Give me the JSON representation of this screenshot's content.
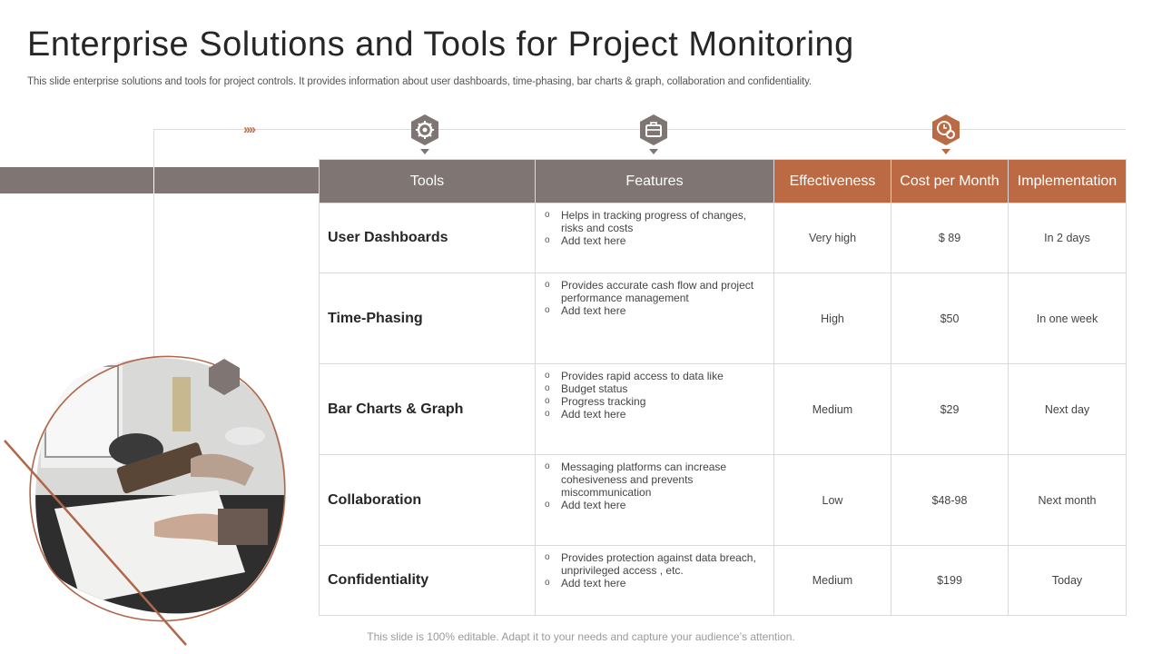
{
  "page": {
    "title": "Enterprise Solutions and Tools for Project Monitoring",
    "subtitle": "This slide enterprise solutions and tools for project controls. It provides information about user dashboards, time-phasing, bar charts & graph, collaboration and confidentiality.",
    "footer": "This slide is 100% editable. Adapt it to your needs and capture your audience’s attention.",
    "chevrons": "››››"
  },
  "colors": {
    "accent": "#bc6a44",
    "neutral": "#7f7572",
    "border": "#d9d9d9"
  },
  "icons": [
    "tools-gear-icon",
    "briefcase-icon",
    "clock-gear-icon"
  ],
  "table": {
    "headers": [
      "Tools",
      "Features",
      "Effectiveness",
      "Cost per Month",
      "Implementation"
    ],
    "rows": [
      {
        "tool": "User Dashboards",
        "features": [
          "Helps in tracking progress of changes, risks and costs",
          "Add text here"
        ],
        "effectiveness": "Very high",
        "cost": "$ 89",
        "implementation": "In 2 days"
      },
      {
        "tool": "Time-Phasing",
        "features": [
          "Provides accurate cash flow and project performance management",
          "Add text here"
        ],
        "effectiveness": "High",
        "cost": "$50",
        "implementation": "In one week"
      },
      {
        "tool": "Bar Charts & Graph",
        "features": [
          "Provides rapid access to data like",
          "Budget status",
          "Progress tracking",
          "Add text here"
        ],
        "effectiveness": "Medium",
        "cost": "$29",
        "implementation": "Next day"
      },
      {
        "tool": "Collaboration",
        "features": [
          "Messaging platforms can increase cohesiveness and prevents miscommunication",
          "Add text here"
        ],
        "effectiveness": "Low",
        "cost": "$48-98",
        "implementation": "Next month"
      },
      {
        "tool": "Confidentiality",
        "features": [
          "Provides protection against data breach, unprivileged access , etc.",
          "Add text here"
        ],
        "effectiveness": "Medium",
        "cost": "$199",
        "implementation": "Today"
      }
    ]
  }
}
